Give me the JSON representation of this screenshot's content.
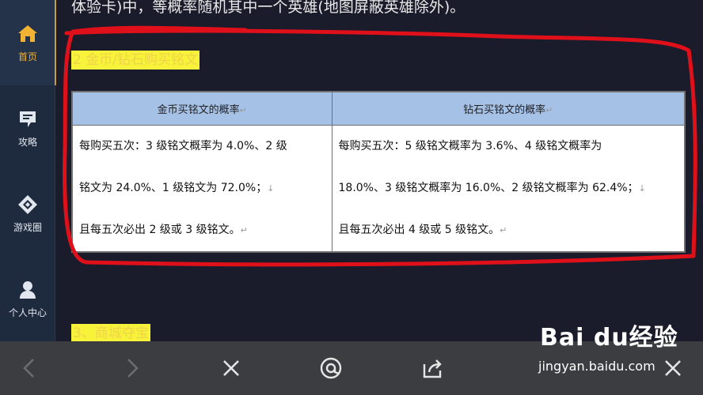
{
  "sidebar": {
    "items": [
      {
        "label": "首页",
        "icon": "home-icon",
        "active": true
      },
      {
        "label": "攻略",
        "icon": "guide-icon"
      },
      {
        "label": "游戏圈",
        "icon": "game-circle-icon"
      },
      {
        "label": "个人中心",
        "icon": "profile-icon"
      }
    ],
    "active_color": "#f2b233"
  },
  "article": {
    "prev_text": "体验卡)中，等概率随机其中一个英雄(地图屏蔽英雄除外)。",
    "section2_heading": "2 金币/钻石购买铭文",
    "section3_heading": "3、商城夺宝",
    "table": {
      "headers": [
        "金币买铭文的概率",
        "钻石买铭文的概率"
      ],
      "header_mark": "↵",
      "col1_lines": [
        "每购买五次：3 级铭文概率为 4.0%、2 级",
        "铭文为 24.0%、1 级铭文为 72.0%；",
        "且每五次必出 2 级或 3 级铭文。"
      ],
      "col2_lines": [
        "每购买五次：5 级铭文概率为 3.6%、4 级铭文概率为",
        "18.0%、3 级铭文概率为 16.0%、2 级铭文概率为 62.4%；",
        "且每五次必出 4 级或 5 级铭文。"
      ],
      "line_break_mark": "↓",
      "para_mark": "↵"
    },
    "highlight_color": "#f7f33a",
    "annotation_color": "#e0101a"
  },
  "toolbar": {
    "buttons": [
      "back-icon",
      "forward-icon",
      "close-icon",
      "at-icon",
      "share-icon",
      "close-icon"
    ]
  },
  "watermark": {
    "brand": "Bai du经验",
    "url": "jingyan.baidu.com"
  }
}
